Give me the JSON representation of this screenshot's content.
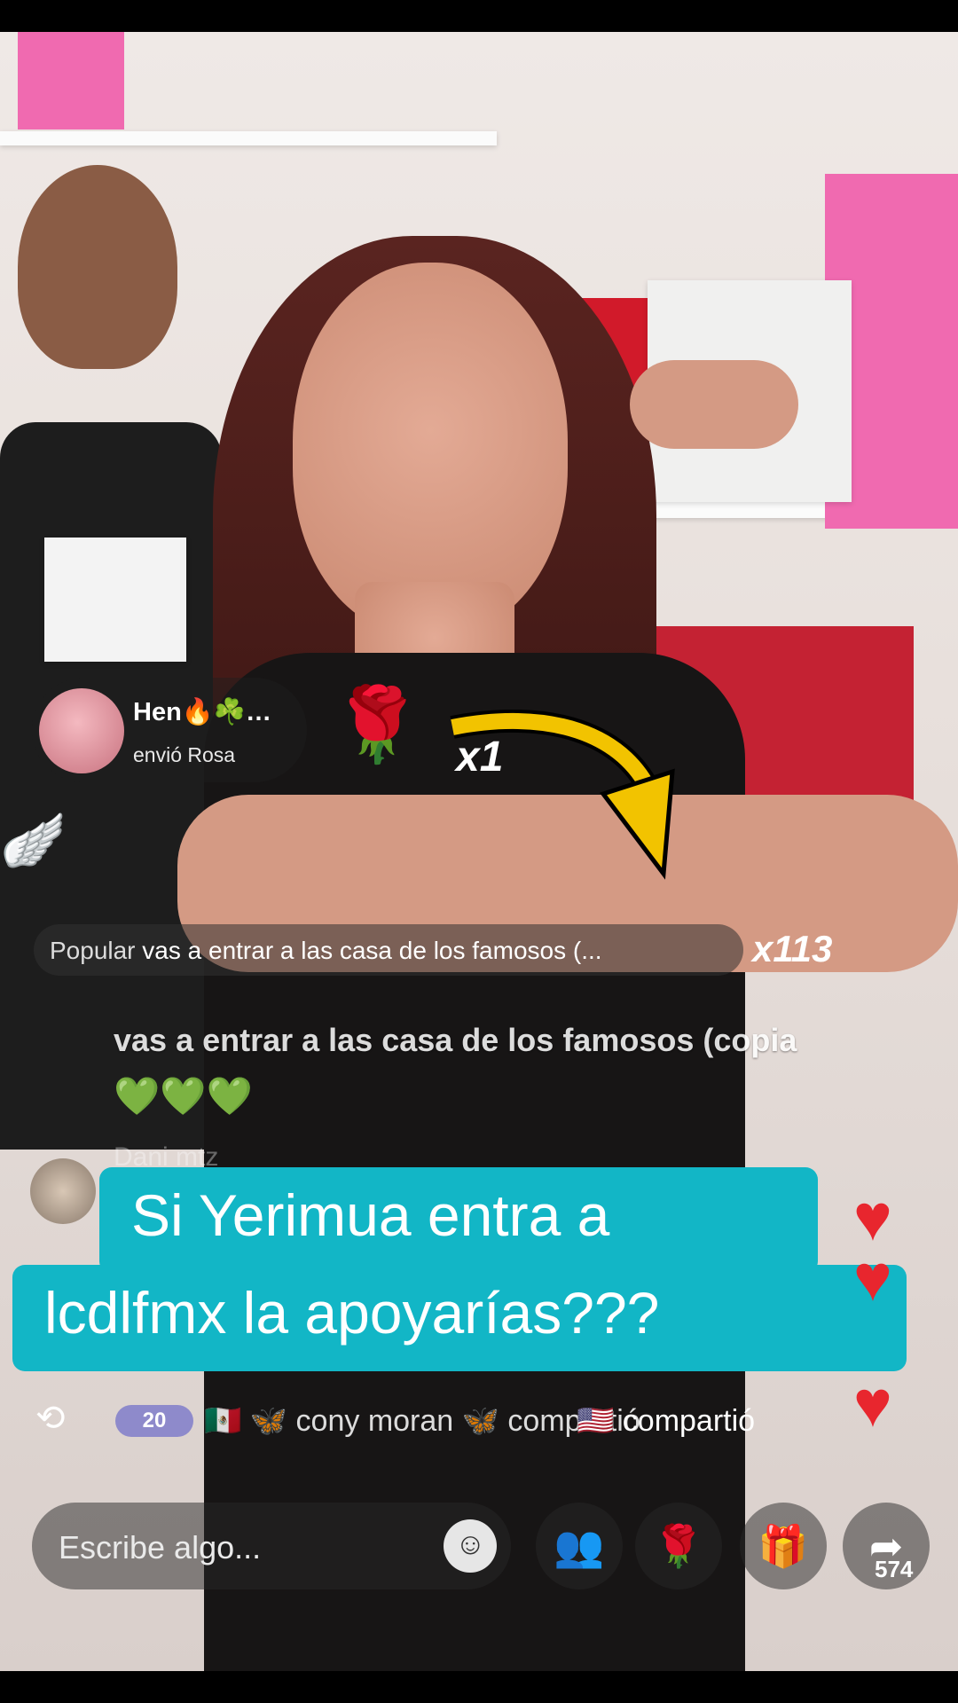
{
  "gift": {
    "user": "Hen🔥☘️…",
    "action": "envió Rosa",
    "count": "x1"
  },
  "popular": {
    "label": "Popular",
    "text": "vas a entrar a las casa de los famosos (...",
    "count": "x113"
  },
  "chat": {
    "message": "vas a entrar a las casa de los famosos (copia",
    "hearts": "💚💚💚",
    "user_faded": "Dani mtz"
  },
  "caption": {
    "line1": "Si Yerimua entra  a",
    "line2": "lcdlfmx la apoyarías???"
  },
  "share_row": {
    "level": "20",
    "text1": "🇲🇽 🦋 cony moran 🦋 compartió",
    "text2": "🇺🇸 compartió"
  },
  "input": {
    "placeholder": "Escribe algo..."
  },
  "buttons": {
    "share_count": "574"
  },
  "colors": {
    "caption_bg": "#12b6c6",
    "heart": "#e8262e",
    "gift_arrow": "#f2c300"
  },
  "icons": [
    "share-icon",
    "smile-icon",
    "people-icon",
    "rose-icon",
    "gift-icon",
    "share-arrow-icon",
    "heart-icon"
  ]
}
